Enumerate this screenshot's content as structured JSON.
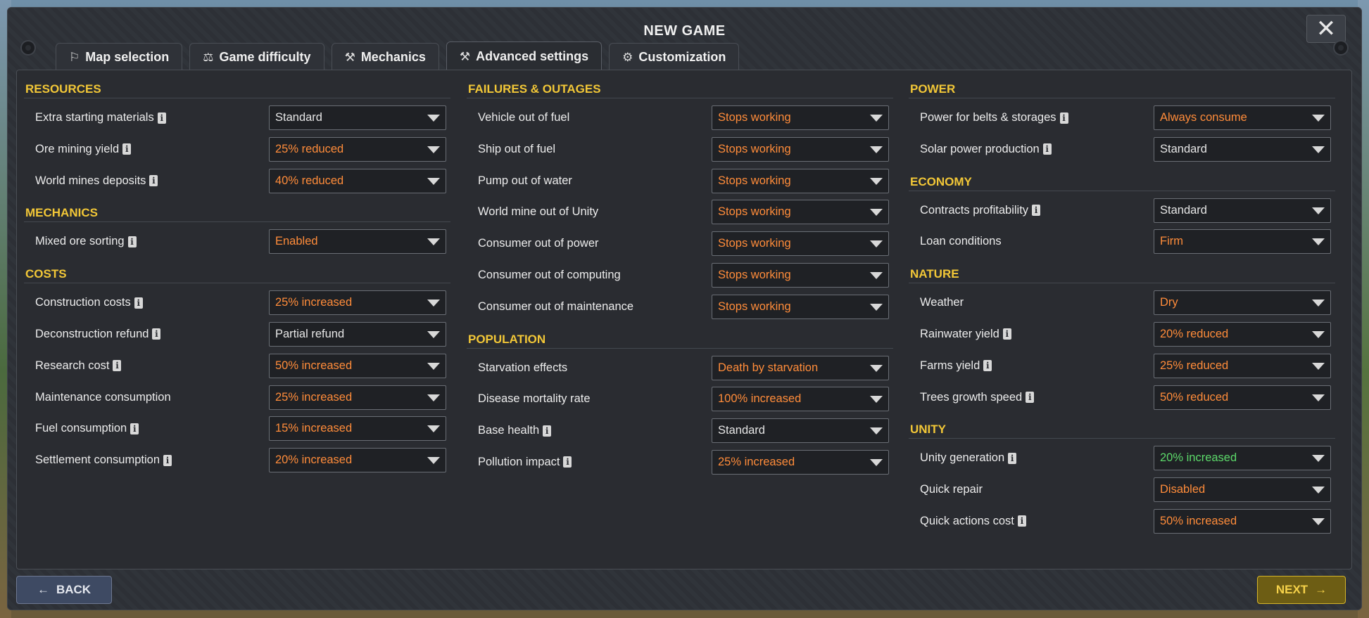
{
  "window": {
    "title": "NEW GAME"
  },
  "colors": {
    "accent": "#f2c737",
    "bad": "#ff8c3a",
    "good": "#5cd96a",
    "neutral": "#e6e6e6"
  },
  "tabs": [
    {
      "label": "Map selection",
      "icon": "map-person-icon"
    },
    {
      "label": "Game difficulty",
      "icon": "scales-icon"
    },
    {
      "label": "Mechanics",
      "icon": "hammer-icon"
    },
    {
      "label": "Advanced settings",
      "icon": "wrench-icon",
      "active": true
    },
    {
      "label": "Customization",
      "icon": "gears-icon"
    }
  ],
  "columns": [
    {
      "sections": [
        {
          "title": "RESOURCES",
          "rows": [
            {
              "label": "Extra starting materials",
              "info": true,
              "value": "Standard",
              "tone": "standard"
            },
            {
              "label": "Ore mining yield",
              "info": true,
              "value": "25% reduced",
              "tone": "bad"
            },
            {
              "label": "World mines deposits",
              "info": true,
              "value": "40% reduced",
              "tone": "bad"
            }
          ]
        },
        {
          "title": "MECHANICS",
          "rows": [
            {
              "label": "Mixed ore sorting",
              "info": true,
              "value": "Enabled",
              "tone": "bad"
            }
          ]
        },
        {
          "title": "COSTS",
          "rows": [
            {
              "label": "Construction costs",
              "info": true,
              "value": "25% increased",
              "tone": "bad"
            },
            {
              "label": "Deconstruction refund",
              "info": true,
              "value": "Partial refund",
              "tone": "standard"
            },
            {
              "label": "Research cost",
              "info": true,
              "value": "50% increased",
              "tone": "bad"
            },
            {
              "label": "Maintenance consumption",
              "info": false,
              "value": "25% increased",
              "tone": "bad"
            },
            {
              "label": "Fuel consumption",
              "info": true,
              "value": "15% increased",
              "tone": "bad"
            },
            {
              "label": "Settlement consumption",
              "info": true,
              "value": "20% increased",
              "tone": "bad"
            }
          ]
        }
      ]
    },
    {
      "sections": [
        {
          "title": "FAILURES & OUTAGES",
          "rows": [
            {
              "label": "Vehicle out of fuel",
              "info": false,
              "value": "Stops working",
              "tone": "bad"
            },
            {
              "label": "Ship out of fuel",
              "info": false,
              "value": "Stops working",
              "tone": "bad"
            },
            {
              "label": "Pump out of water",
              "info": false,
              "value": "Stops working",
              "tone": "bad"
            },
            {
              "label": "World mine out of Unity",
              "info": false,
              "value": "Stops working",
              "tone": "bad"
            },
            {
              "label": "Consumer out of power",
              "info": false,
              "value": "Stops working",
              "tone": "bad"
            },
            {
              "label": "Consumer out of computing",
              "info": false,
              "value": "Stops working",
              "tone": "bad"
            },
            {
              "label": "Consumer out of maintenance",
              "info": false,
              "value": "Stops working",
              "tone": "bad"
            }
          ]
        },
        {
          "title": "POPULATION",
          "rows": [
            {
              "label": "Starvation effects",
              "info": false,
              "value": "Death by starvation",
              "tone": "bad"
            },
            {
              "label": "Disease mortality rate",
              "info": false,
              "value": "100% increased",
              "tone": "bad"
            },
            {
              "label": "Base health",
              "info": true,
              "value": "Standard",
              "tone": "standard"
            },
            {
              "label": "Pollution impact",
              "info": true,
              "value": "25% increased",
              "tone": "bad"
            }
          ]
        }
      ]
    },
    {
      "sections": [
        {
          "title": "POWER",
          "rows": [
            {
              "label": "Power for belts & storages",
              "info": true,
              "value": "Always consume",
              "tone": "bad"
            },
            {
              "label": "Solar power production",
              "info": true,
              "value": "Standard",
              "tone": "standard"
            }
          ]
        },
        {
          "title": "ECONOMY",
          "rows": [
            {
              "label": "Contracts profitability",
              "info": true,
              "value": "Standard",
              "tone": "standard"
            },
            {
              "label": "Loan conditions",
              "info": false,
              "value": "Firm",
              "tone": "bad"
            }
          ]
        },
        {
          "title": "NATURE",
          "rows": [
            {
              "label": "Weather",
              "info": false,
              "value": "Dry",
              "tone": "bad"
            },
            {
              "label": "Rainwater yield",
              "info": true,
              "value": "20% reduced",
              "tone": "bad"
            },
            {
              "label": "Farms yield",
              "info": true,
              "value": "25% reduced",
              "tone": "bad"
            },
            {
              "label": "Trees growth speed",
              "info": true,
              "value": "50% reduced",
              "tone": "bad"
            }
          ]
        },
        {
          "title": "UNITY",
          "rows": [
            {
              "label": "Unity generation",
              "info": true,
              "value": "20% increased",
              "tone": "good"
            },
            {
              "label": "Quick repair",
              "info": false,
              "value": "Disabled",
              "tone": "bad"
            },
            {
              "label": "Quick actions cost",
              "info": true,
              "value": "50% increased",
              "tone": "bad"
            }
          ]
        }
      ]
    }
  ],
  "footer": {
    "back_label": "BACK",
    "next_label": "NEXT"
  }
}
